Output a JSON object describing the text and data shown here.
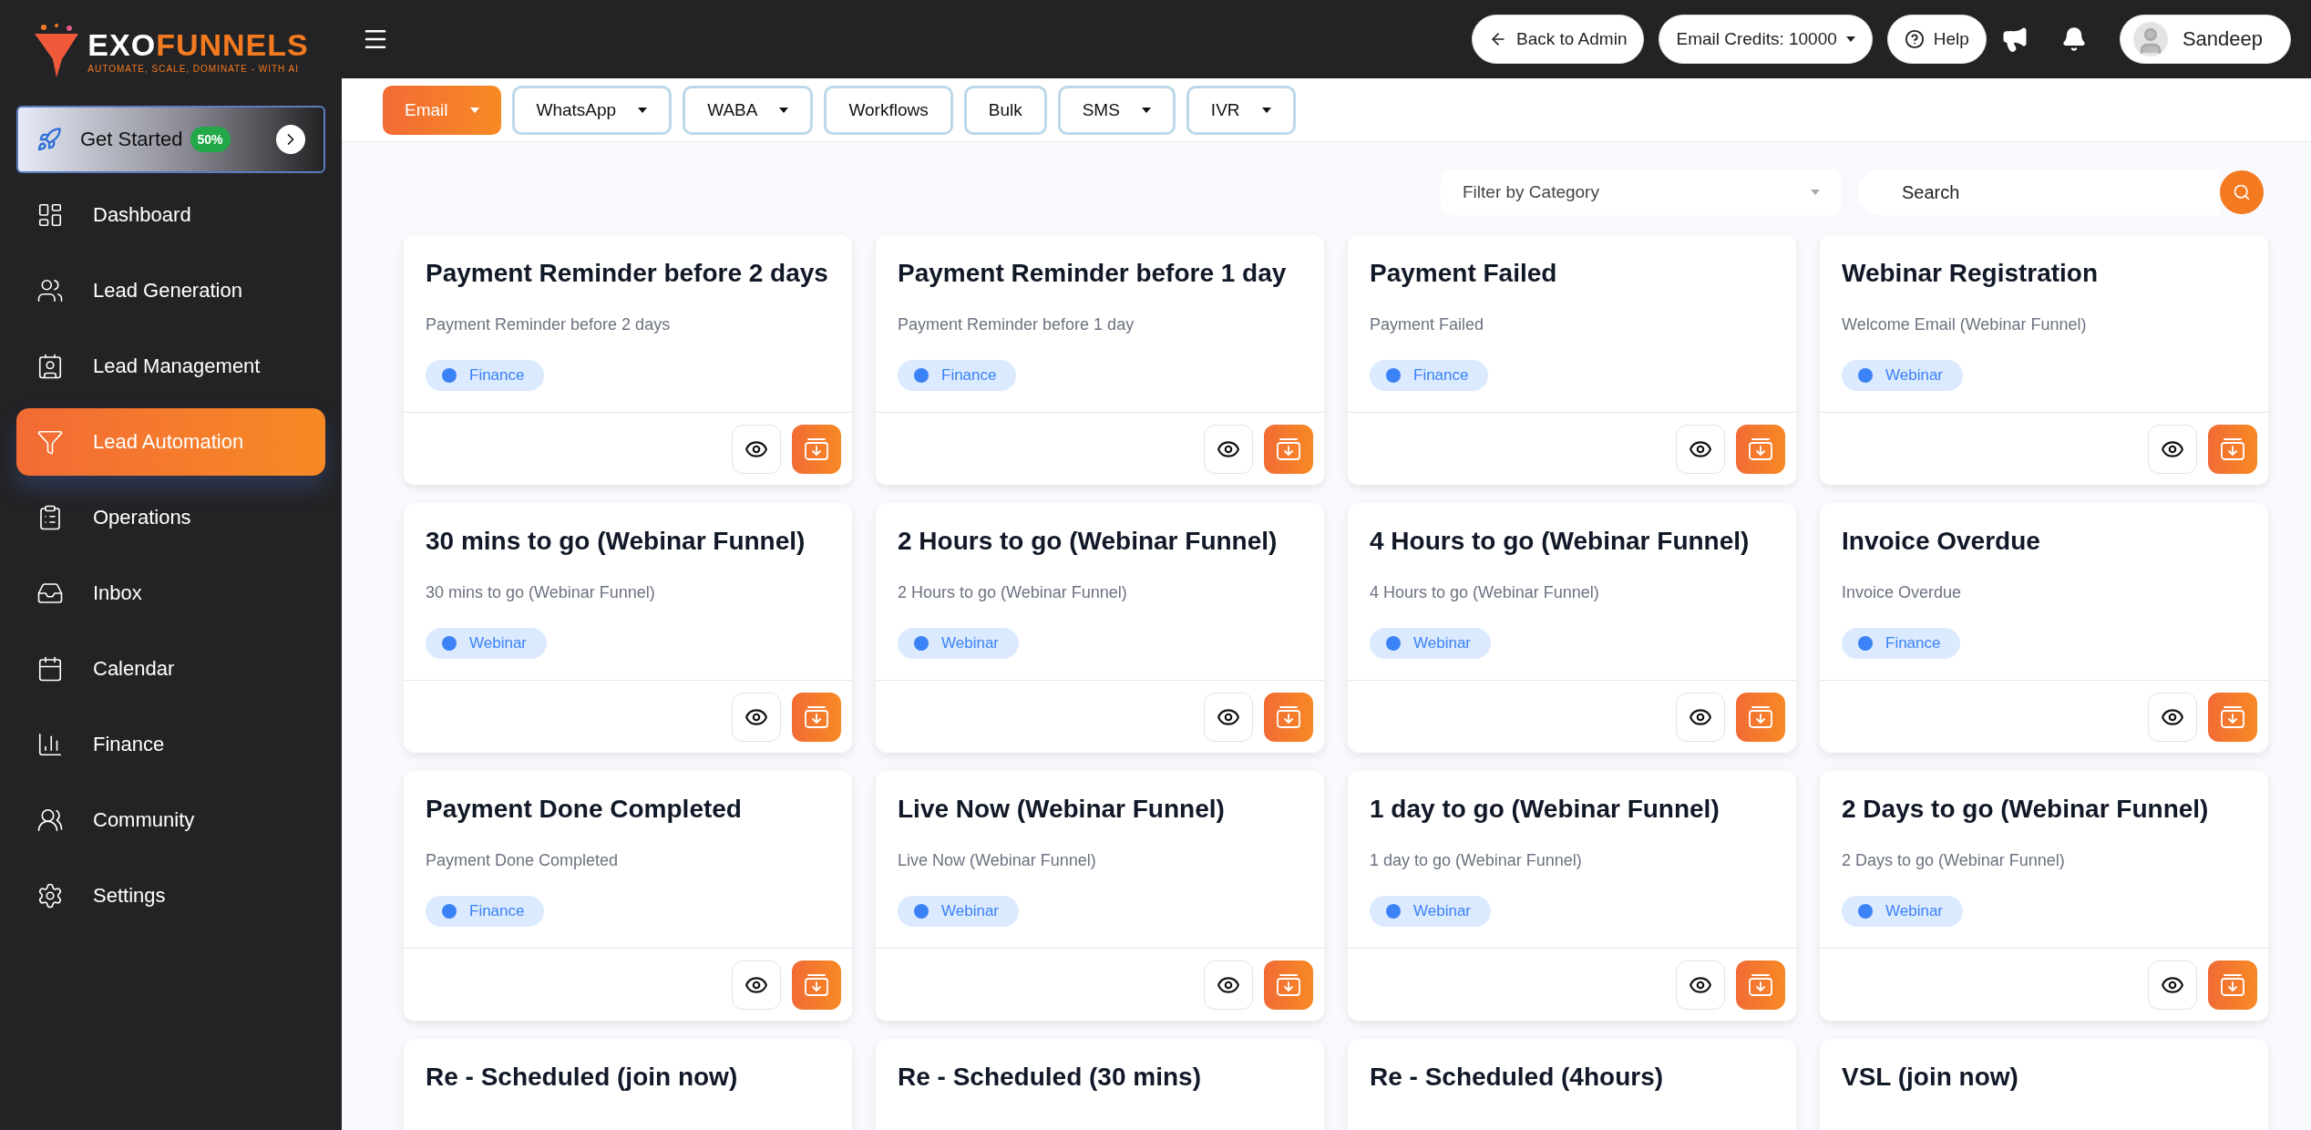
{
  "logo": {
    "brand_light": "EXO",
    "brand_accent": "FUNNELS",
    "tagline": "AUTOMATE, SCALE, DOMINATE - WITH AI"
  },
  "get_started": {
    "label": "Get Started",
    "badge": "50%"
  },
  "sidebar": {
    "items": [
      {
        "label": "Dashboard",
        "selected": false
      },
      {
        "label": "Lead Generation",
        "selected": false
      },
      {
        "label": "Lead Management",
        "selected": false
      },
      {
        "label": "Lead Automation",
        "selected": true
      },
      {
        "label": "Operations",
        "selected": false
      },
      {
        "label": "Inbox",
        "selected": false
      },
      {
        "label": "Calendar",
        "selected": false
      },
      {
        "label": "Finance",
        "selected": false
      },
      {
        "label": "Community",
        "selected": false
      },
      {
        "label": "Settings",
        "selected": false
      }
    ]
  },
  "topbar": {
    "back": "Back to Admin",
    "credits": "Email Credits: 10000",
    "help": "Help",
    "user": "Sandeep"
  },
  "tabs": [
    {
      "label": "Email",
      "selected": true,
      "dropdown": true
    },
    {
      "label": "WhatsApp",
      "selected": false,
      "dropdown": true
    },
    {
      "label": "WABA",
      "selected": false,
      "dropdown": true
    },
    {
      "label": "Workflows",
      "selected": false,
      "dropdown": false
    },
    {
      "label": "Bulk",
      "selected": false,
      "dropdown": false
    },
    {
      "label": "SMS",
      "selected": false,
      "dropdown": true
    },
    {
      "label": "IVR",
      "selected": false,
      "dropdown": true
    }
  ],
  "filter": {
    "placeholder": "Filter by Category"
  },
  "search": {
    "placeholder": "Search"
  },
  "cards": [
    {
      "title": "Payment Reminder before 2 days",
      "subtitle": "Payment Reminder before 2 days",
      "tag": "Finance"
    },
    {
      "title": "Payment Reminder before 1 day",
      "subtitle": "Payment Reminder before 1 day",
      "tag": "Finance"
    },
    {
      "title": "Payment Failed",
      "subtitle": "Payment Failed",
      "tag": "Finance"
    },
    {
      "title": "Webinar Registration",
      "subtitle": "Welcome Email (Webinar Funnel)",
      "tag": "Webinar"
    },
    {
      "title": "30 mins to go (Webinar Funnel)",
      "subtitle": "30 mins to go (Webinar Funnel)",
      "tag": "Webinar"
    },
    {
      "title": "2 Hours to go (Webinar Funnel)",
      "subtitle": "2 Hours to go (Webinar Funnel)",
      "tag": "Webinar"
    },
    {
      "title": "4 Hours to go (Webinar Funnel)",
      "subtitle": "4 Hours to go (Webinar Funnel)",
      "tag": "Webinar"
    },
    {
      "title": "Invoice Overdue",
      "subtitle": "Invoice Overdue",
      "tag": "Finance"
    },
    {
      "title": "Payment Done Completed",
      "subtitle": "Payment Done Completed",
      "tag": "Finance"
    },
    {
      "title": "Live Now (Webinar Funnel)",
      "subtitle": "Live Now (Webinar Funnel)",
      "tag": "Webinar"
    },
    {
      "title": "1 day to go (Webinar Funnel)",
      "subtitle": "1 day to go (Webinar Funnel)",
      "tag": "Webinar"
    },
    {
      "title": "2 Days to go (Webinar Funnel)",
      "subtitle": "2 Days to go (Webinar Funnel)",
      "tag": "Webinar"
    },
    {
      "title": "Re - Scheduled (join now)"
    },
    {
      "title": "Re - Scheduled (30 mins)"
    },
    {
      "title": "Re - Scheduled (4hours)"
    },
    {
      "title": "VSL (join now)"
    }
  ]
}
